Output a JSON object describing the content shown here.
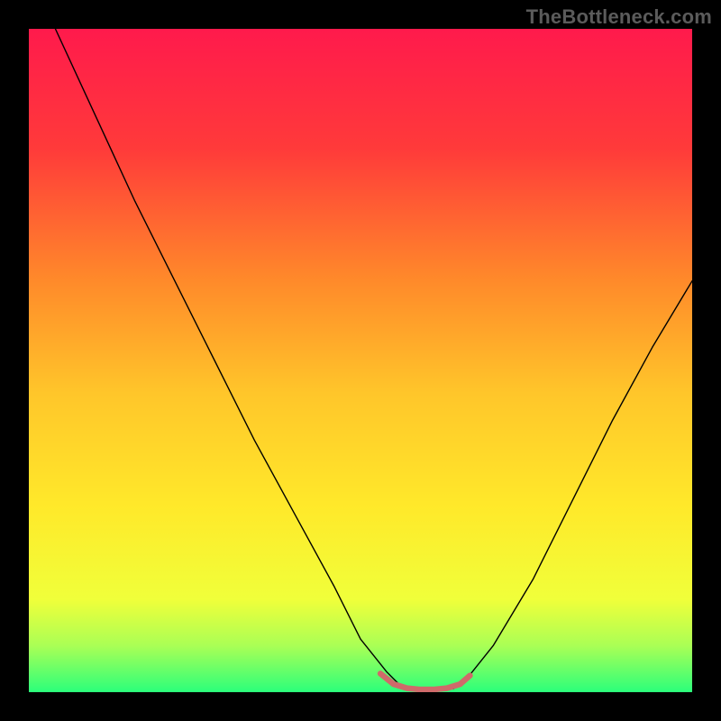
{
  "watermark": "TheBottleneck.com",
  "chart_data": {
    "type": "line",
    "title": "",
    "xlabel": "",
    "ylabel": "",
    "xlim": [
      0,
      100
    ],
    "ylim": [
      0,
      100
    ],
    "grid": false,
    "legend": false,
    "background_gradient": {
      "stops": [
        {
          "offset": 0.0,
          "color": "#ff1a4c"
        },
        {
          "offset": 0.18,
          "color": "#ff3a3a"
        },
        {
          "offset": 0.38,
          "color": "#ff8a2a"
        },
        {
          "offset": 0.55,
          "color": "#ffc62a"
        },
        {
          "offset": 0.72,
          "color": "#ffe92a"
        },
        {
          "offset": 0.86,
          "color": "#f0ff3a"
        },
        {
          "offset": 0.93,
          "color": "#aaff55"
        },
        {
          "offset": 1.0,
          "color": "#2bff7b"
        }
      ]
    },
    "series": [
      {
        "name": "bottleneck-curve",
        "stroke": "#000000",
        "stroke_width": 1.4,
        "x": [
          4,
          10,
          16,
          22,
          28,
          34,
          40,
          46,
          50,
          54,
          56,
          60,
          64,
          66,
          70,
          76,
          82,
          88,
          94,
          100
        ],
        "y": [
          100,
          87,
          74,
          62,
          50,
          38,
          27,
          16,
          8,
          3,
          1,
          0.5,
          0.5,
          2,
          7,
          17,
          29,
          41,
          52,
          62
        ]
      },
      {
        "name": "optimal-band",
        "stroke": "#cf6a6a",
        "stroke_width": 6.5,
        "x": [
          53,
          55,
          57,
          59,
          61,
          63,
          65,
          66.5
        ],
        "y": [
          2.8,
          1.2,
          0.6,
          0.4,
          0.4,
          0.6,
          1.2,
          2.5
        ]
      }
    ]
  }
}
